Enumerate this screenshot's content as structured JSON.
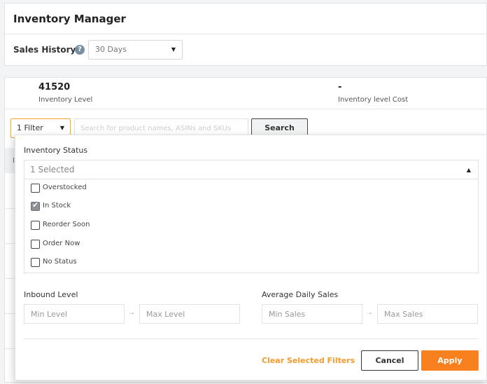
{
  "app": {
    "title": "Inventory Manager"
  },
  "sales_history": {
    "label": "Sales History:",
    "help_icon_glyph": "?",
    "selected": "30 Days",
    "caret_glyph": "▼"
  },
  "metrics": [
    {
      "value": "41520",
      "label": "Inventory Level"
    },
    {
      "value": "-",
      "label": "Inventory level Cost"
    }
  ],
  "toolbar": {
    "filter_label": "1 Filter",
    "filter_caret": "▼",
    "search_placeholder": "Search for product names, ASINs and SKUs",
    "search_button": "Search"
  },
  "table": {
    "header_glyph": "I"
  },
  "filter_panel": {
    "inventory_status": {
      "title": "Inventory Status",
      "selected_summary": "1 Selected",
      "caret_glyph": "▲",
      "options": [
        {
          "label": "Overstocked",
          "checked": false
        },
        {
          "label": "In Stock",
          "checked": true
        },
        {
          "label": "Reorder Soon",
          "checked": false
        },
        {
          "label": "Order Now",
          "checked": false
        },
        {
          "label": "No Status",
          "checked": false
        }
      ],
      "check_glyph": "✔"
    },
    "inbound_level": {
      "title": "Inbound Level",
      "min_placeholder": "Min Level",
      "max_placeholder": "Max Level",
      "arrow_glyph": "→"
    },
    "average_daily_sales": {
      "title": "Average Daily Sales",
      "min_placeholder": "Min Sales",
      "max_placeholder": "Max Sales",
      "arrow_glyph": "→"
    },
    "clear_label": "Clear Selected Filters",
    "cancel_label": "Cancel",
    "apply_label": "Apply"
  },
  "colors": {
    "accent": "#f7811e",
    "link": "#f59a2e",
    "border": "#dfe1e4"
  }
}
